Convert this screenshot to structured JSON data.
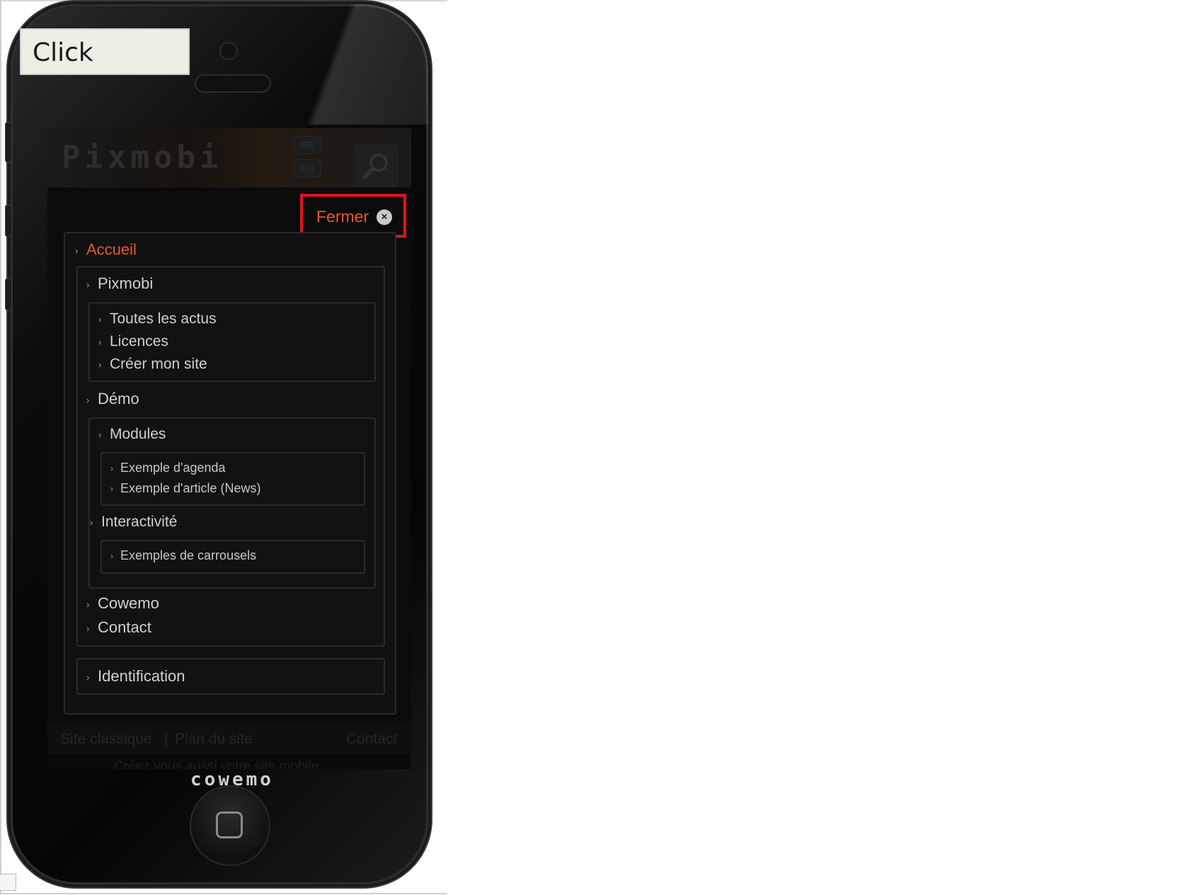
{
  "callout": {
    "text": "Click"
  },
  "app": {
    "logo": "Pixmobi",
    "languages": [
      "FR",
      "EN"
    ]
  },
  "menu": {
    "close_label": "Fermer",
    "close_icon": "close-icon",
    "items": {
      "accueil": "Accueil",
      "pixmobi": "Pixmobi",
      "toutes_les_actus": "Toutes les actus",
      "licences": "Licences",
      "creer_mon_site": "Créer mon site",
      "demo": "Démo",
      "modules": "Modules",
      "exemple_agenda": "Exemple d'agenda",
      "exemple_article": "Exemple d'article (News)",
      "interactivite": "Interactivité",
      "exemples_carrousels": "Exemples de carrousels",
      "cowemo": "Cowemo",
      "contact": "Contact",
      "identification": "Identification"
    },
    "active_item": "Accueil"
  },
  "footer": {
    "site_classique": "Site classique",
    "separator": "|",
    "plan_du_site": "Plan du site",
    "contact": "Contact",
    "credit": "Créez vous aussi votre site mobile"
  },
  "device": {
    "brand": "cowemo"
  },
  "colors": {
    "accent": "#e35a2c",
    "highlight_border": "#e1141b",
    "callout_bg": "#efeee4"
  }
}
